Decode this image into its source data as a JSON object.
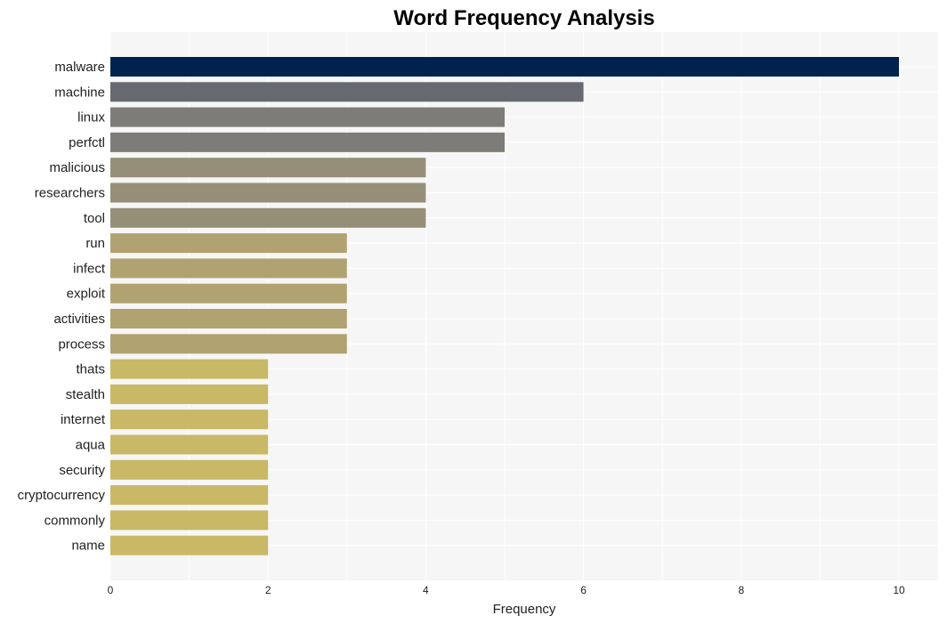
{
  "chart_data": {
    "type": "bar",
    "orientation": "horizontal",
    "title": "Word Frequency Analysis",
    "xlabel": "Frequency",
    "ylabel": "",
    "xlim": [
      0,
      10.5
    ],
    "xticks": [
      0,
      2,
      4,
      6,
      8,
      10
    ],
    "grid": true,
    "categories": [
      "malware",
      "machine",
      "linux",
      "perfctl",
      "malicious",
      "researchers",
      "tool",
      "run",
      "infect",
      "exploit",
      "activities",
      "process",
      "thats",
      "stealth",
      "internet",
      "aqua",
      "security",
      "cryptocurrency",
      "commonly",
      "name"
    ],
    "values": [
      10,
      6,
      5,
      5,
      4,
      4,
      4,
      3,
      3,
      3,
      3,
      3,
      2,
      2,
      2,
      2,
      2,
      2,
      2,
      2
    ],
    "colors": [
      "#00224e",
      "#666970",
      "#7d7c78",
      "#7d7c78",
      "#958f78",
      "#958f78",
      "#958f78",
      "#b0a371",
      "#b0a371",
      "#b0a371",
      "#b0a371",
      "#b0a371",
      "#c9b866",
      "#c9b866",
      "#c9b866",
      "#c9b866",
      "#c9b866",
      "#c9b866",
      "#c9b866",
      "#c9b866"
    ]
  }
}
